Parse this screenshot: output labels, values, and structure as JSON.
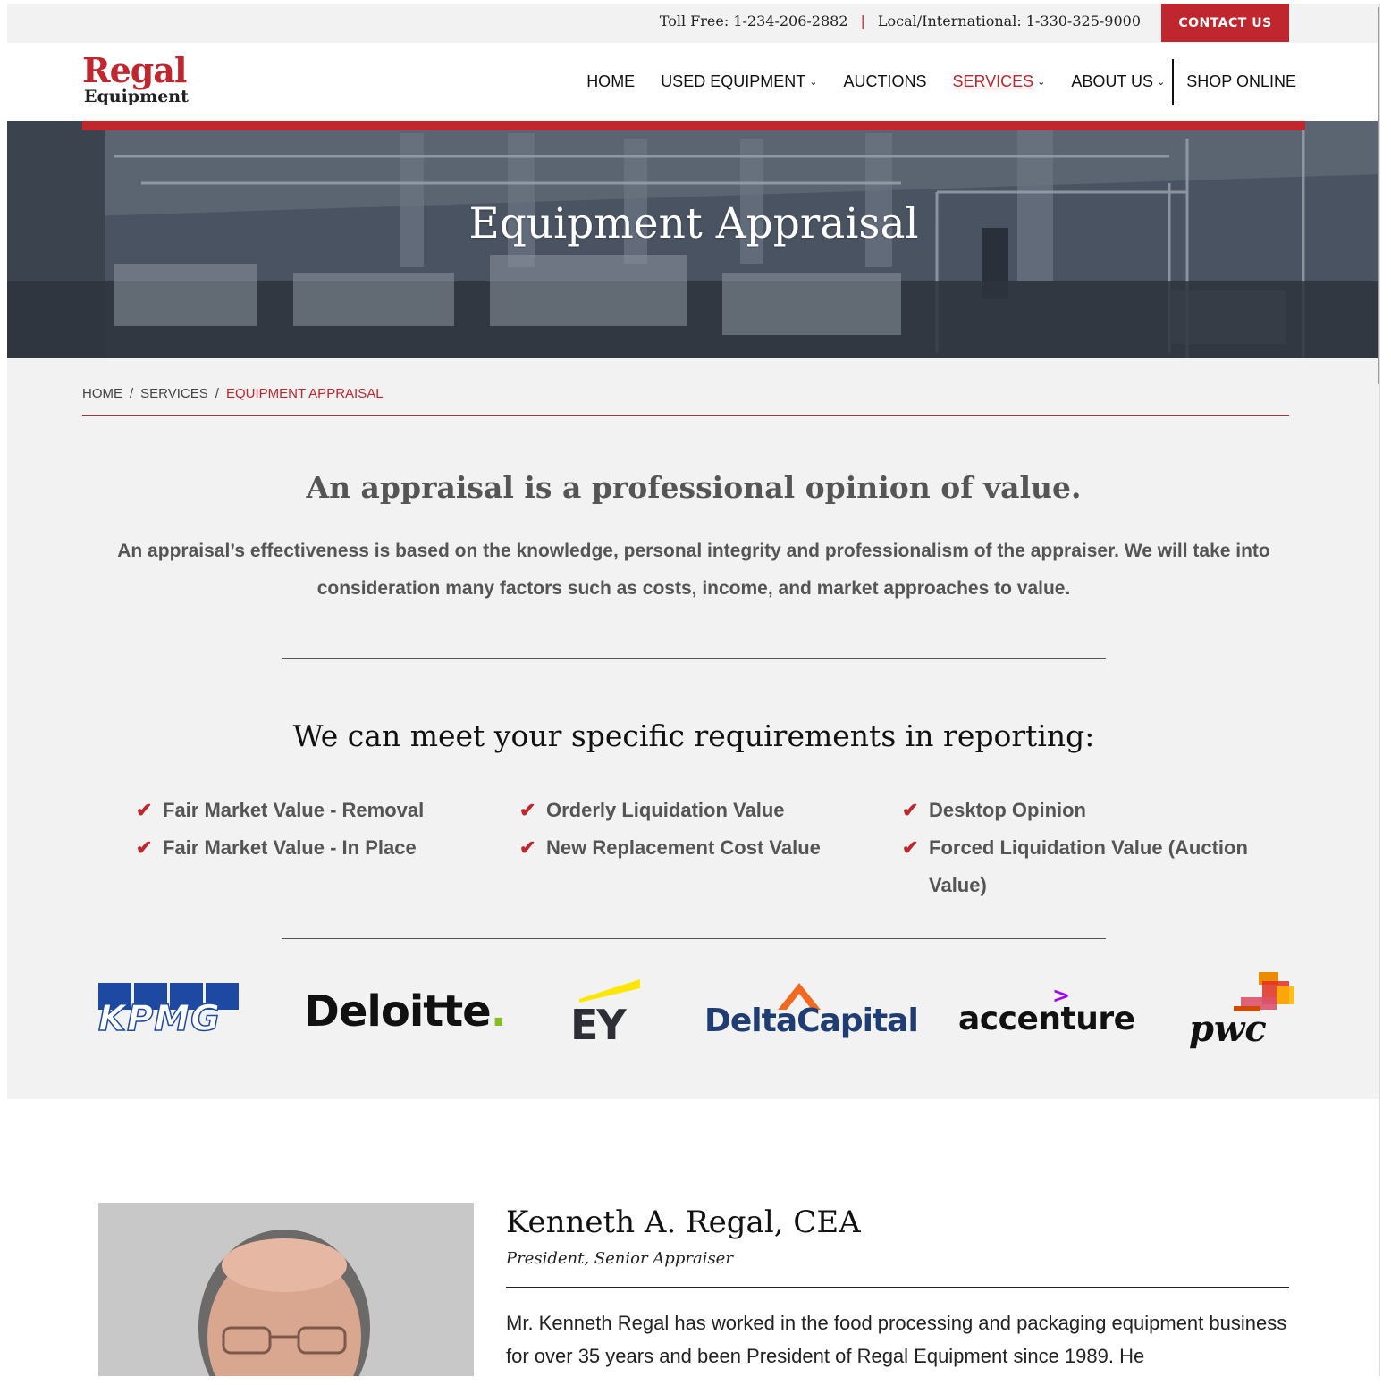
{
  "topbar": {
    "toll_free": "Toll Free: 1-234-206-2882",
    "separator": "|",
    "local": "Local/International: 1-330-325-9000",
    "contact_label": "CONTACT US"
  },
  "logo": {
    "line1": "Regal",
    "line2": "Equipment"
  },
  "nav": {
    "items": [
      {
        "label": "HOME"
      },
      {
        "label": "USED EQUIPMENT",
        "dropdown": true
      },
      {
        "label": "AUCTIONS"
      },
      {
        "label": "SERVICES",
        "dropdown": true,
        "active": true
      },
      {
        "label": "ABOUT US",
        "dropdown": true
      },
      {
        "label": "SHOP ONLINE"
      }
    ]
  },
  "hero": {
    "title": "Equipment Appraisal"
  },
  "breadcrumb": {
    "home": "HOME",
    "services": "SERVICES",
    "current": "EQUIPMENT APPRAISAL",
    "sep": "/"
  },
  "main": {
    "heading": "An appraisal is a professional opinion of value.",
    "intro": "An appraisal’s effectiveness is based on the knowledge, personal integrity and professionalism of the appraiser. We will take into consideration many factors such as costs, income, and market approaches to value.",
    "reporting_heading": "We can meet your specific requirements in reporting:",
    "reporting_columns": [
      [
        "Fair Market Value - Removal",
        "Fair Market Value - In Place"
      ],
      [
        "Orderly Liquidation Value",
        "New Replacement Cost Value"
      ],
      [
        "Desktop Opinion",
        "Forced Liquidation Value (Auction Value)"
      ]
    ]
  },
  "logos": {
    "kpmg": "KPMG",
    "deloitte": "Deloitte",
    "deloitte_dot": ".",
    "ey": "EY",
    "deltacapital": "DeltaCapital",
    "accenture": "accenture",
    "accenture_mark": ">",
    "pwc": "pwc"
  },
  "bio": {
    "name": "Kenneth A. Regal, CEA",
    "role": "President, Senior Appraiser",
    "text": "Mr. Kenneth Regal has worked in the food processing and packaging equipment business for over 35 years and been President of Regal Equipment since 1989. He"
  },
  "colors": {
    "accent": "#c0262d",
    "text_gray": "#555555",
    "background": "#f2f2f2"
  },
  "icons": {
    "check": "check-icon",
    "chevron": "chevron-down-icon"
  }
}
